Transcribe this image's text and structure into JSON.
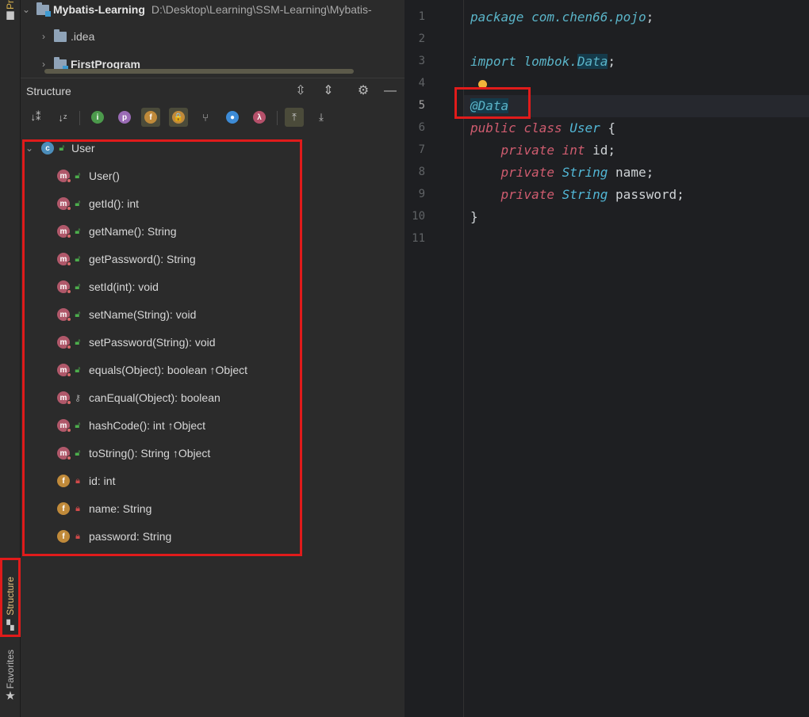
{
  "left_strip": {
    "project_tab": "Pr",
    "structure_tab": "Structure",
    "favorites_tab": "Favorites"
  },
  "project_tree": {
    "root_name": "Mybatis-Learning",
    "root_path": "D:\\Desktop\\Learning\\SSM-Learning\\Mybatis-",
    "items": [
      ".idea",
      "FirstProgram"
    ]
  },
  "structure_panel": {
    "title": "Structure",
    "tree": {
      "class_name": "User",
      "members": [
        {
          "label": "User()",
          "kind": "method",
          "visibility": "public"
        },
        {
          "label": "getId(): int",
          "kind": "method",
          "visibility": "public"
        },
        {
          "label": "getName(): String",
          "kind": "method",
          "visibility": "public"
        },
        {
          "label": "getPassword(): String",
          "kind": "method",
          "visibility": "public"
        },
        {
          "label": "setId(int): void",
          "kind": "method",
          "visibility": "public"
        },
        {
          "label": "setName(String): void",
          "kind": "method",
          "visibility": "public"
        },
        {
          "label": "setPassword(String): void",
          "kind": "method",
          "visibility": "public"
        },
        {
          "label": "equals(Object): boolean ↑Object",
          "kind": "method",
          "visibility": "public"
        },
        {
          "label": "canEqual(Object): boolean",
          "kind": "method",
          "visibility": "protected"
        },
        {
          "label": "hashCode(): int ↑Object",
          "kind": "method",
          "visibility": "public"
        },
        {
          "label": "toString(): String ↑Object",
          "kind": "method",
          "visibility": "public"
        },
        {
          "label": "id: int",
          "kind": "field",
          "visibility": "private"
        },
        {
          "label": "name: String",
          "kind": "field",
          "visibility": "private"
        },
        {
          "label": "password: String",
          "kind": "field",
          "visibility": "private"
        }
      ]
    }
  },
  "editor": {
    "line_numbers": [
      "1",
      "2",
      "3",
      "4",
      "5",
      "6",
      "7",
      "8",
      "9",
      "10",
      "11"
    ],
    "current_line": "5",
    "code": {
      "l1_kw": "package",
      "l1_pkg": "com.chen66.pojo",
      "l1_semi": ";",
      "l3_kw": "import",
      "l3_pkg": "lombok.",
      "l3_cls": "Data",
      "l3_semi": ";",
      "l5_ann": "@Data",
      "l6_kw1": "public",
      "l6_kw2": "class",
      "l6_name": "User",
      "l6_brace": "{",
      "private_kw": "private",
      "l7_type": "int",
      "l7_name": "id",
      "l8_type": "String",
      "l8_name": "name",
      "l9_type": "String",
      "l9_name": "password",
      "semi": ";",
      "l10_brace": "}"
    }
  },
  "colors": {
    "highlight_box": "#e01b1b",
    "keyword": "#cf5c6f",
    "type": "#52b7d6",
    "background": "#1e1f22"
  }
}
